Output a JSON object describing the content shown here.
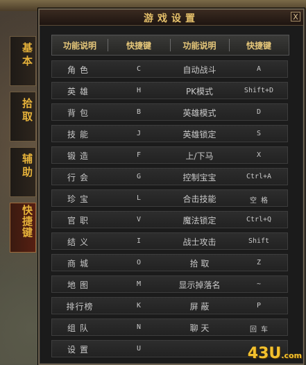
{
  "window": {
    "title": "游戏设置",
    "close_label": "X"
  },
  "tabs": [
    {
      "label": "基本"
    },
    {
      "label": "拾取"
    },
    {
      "label": "辅助"
    },
    {
      "label": "快捷键"
    }
  ],
  "header": {
    "col1": "功能说明",
    "col2": "快捷键",
    "col3": "功能说明",
    "col4": "快捷键"
  },
  "rows": [
    {
      "f1": "角色",
      "k1": "C",
      "f2": "自动战斗",
      "k2": "A"
    },
    {
      "f1": "英雄",
      "k1": "H",
      "f2": "PK模式",
      "k2": "Shift+D"
    },
    {
      "f1": "背包",
      "k1": "B",
      "f2": "英雄模式",
      "k2": "D"
    },
    {
      "f1": "技能",
      "k1": "J",
      "f2": "英雄锁定",
      "k2": "S"
    },
    {
      "f1": "锻造",
      "k1": "F",
      "f2": "上/下马",
      "k2": "X"
    },
    {
      "f1": "行会",
      "k1": "G",
      "f2": "控制宝宝",
      "k2": "Ctrl+A"
    },
    {
      "f1": "珍宝",
      "k1": "L",
      "f2": "合击技能",
      "k2": "空 格"
    },
    {
      "f1": "官职",
      "k1": "V",
      "f2": "魔法锁定",
      "k2": "Ctrl+Q"
    },
    {
      "f1": "结义",
      "k1": "I",
      "f2": "战士攻击",
      "k2": "Shift"
    },
    {
      "f1": "商城",
      "k1": "O",
      "f2": "拾 取",
      "k2": "Z"
    },
    {
      "f1": "地图",
      "k1": "M",
      "f2": "显示掉落名",
      "k2": "~"
    },
    {
      "f1": "排行榜",
      "k1": "K",
      "f2": "屏 蔽",
      "k2": "P"
    },
    {
      "f1": "组队",
      "k1": "N",
      "f2": "聊 天",
      "k2": "回 车"
    },
    {
      "f1": "设置",
      "k1": "U",
      "f2": "",
      "k2": ""
    }
  ],
  "watermark": {
    "main": "43U",
    "suffix": ".com"
  }
}
